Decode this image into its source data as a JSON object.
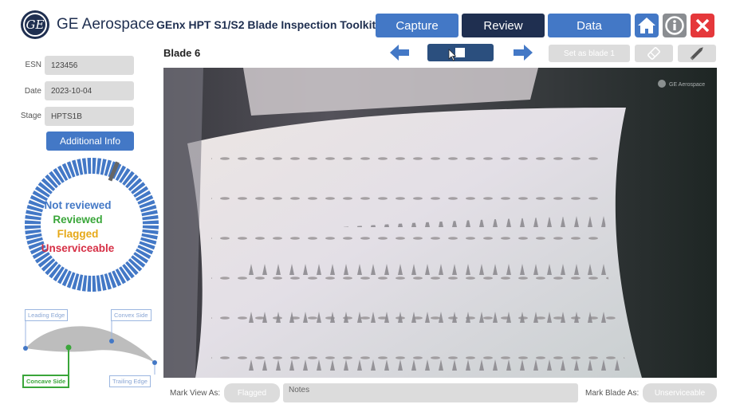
{
  "header": {
    "brand_mark": "GE",
    "brand": "GE Aerospace",
    "app_title": "GEnx HPT S1/S2 Blade Inspection Toolkit",
    "tabs": {
      "capture": "Capture",
      "review": "Review",
      "data": "Data"
    },
    "active_tab": "Review",
    "icons": [
      "home-icon",
      "info-icon",
      "close-icon"
    ],
    "colors": {
      "primary": "#4378c6",
      "dark": "#1f2f50",
      "close": "#e5383b"
    }
  },
  "info": {
    "esn_label": "ESN",
    "esn_value": "123456",
    "date_label": "Date",
    "date_value": "2023-10-04",
    "stage_label": "Stage",
    "stage_value": "HPTS1B",
    "additional_info": "Additional Info"
  },
  "status_legend": {
    "not_reviewed": {
      "label": "Not reviewed",
      "color": "#4378c6"
    },
    "reviewed": {
      "label": "Reviewed",
      "color": "#3aa63a"
    },
    "flagged": {
      "label": "Flagged",
      "color": "#e6a817"
    },
    "unserviceable": {
      "label": "Unserviceable",
      "color": "#d62f45"
    }
  },
  "blade_views": {
    "leading_edge": "Leading Edge",
    "convex_side": "Convex Side",
    "concave_side": "Concave Side",
    "trailing_edge": "Trailing Edge",
    "selected": "Concave Side"
  },
  "viewer": {
    "blade_title": "Blade 6",
    "set_as_blade": "Set as blade 1",
    "watermark": "GE Aerospace",
    "icons": [
      "arrow-left-icon",
      "stop-icon",
      "arrow-right-icon",
      "eraser-icon",
      "pencil-icon"
    ]
  },
  "footer": {
    "mark_view_label": "Mark View As:",
    "mark_view_button": "Flagged",
    "notes_placeholder": "Notes",
    "mark_blade_label": "Mark Blade As:",
    "mark_blade_button": "Unserviceable"
  }
}
